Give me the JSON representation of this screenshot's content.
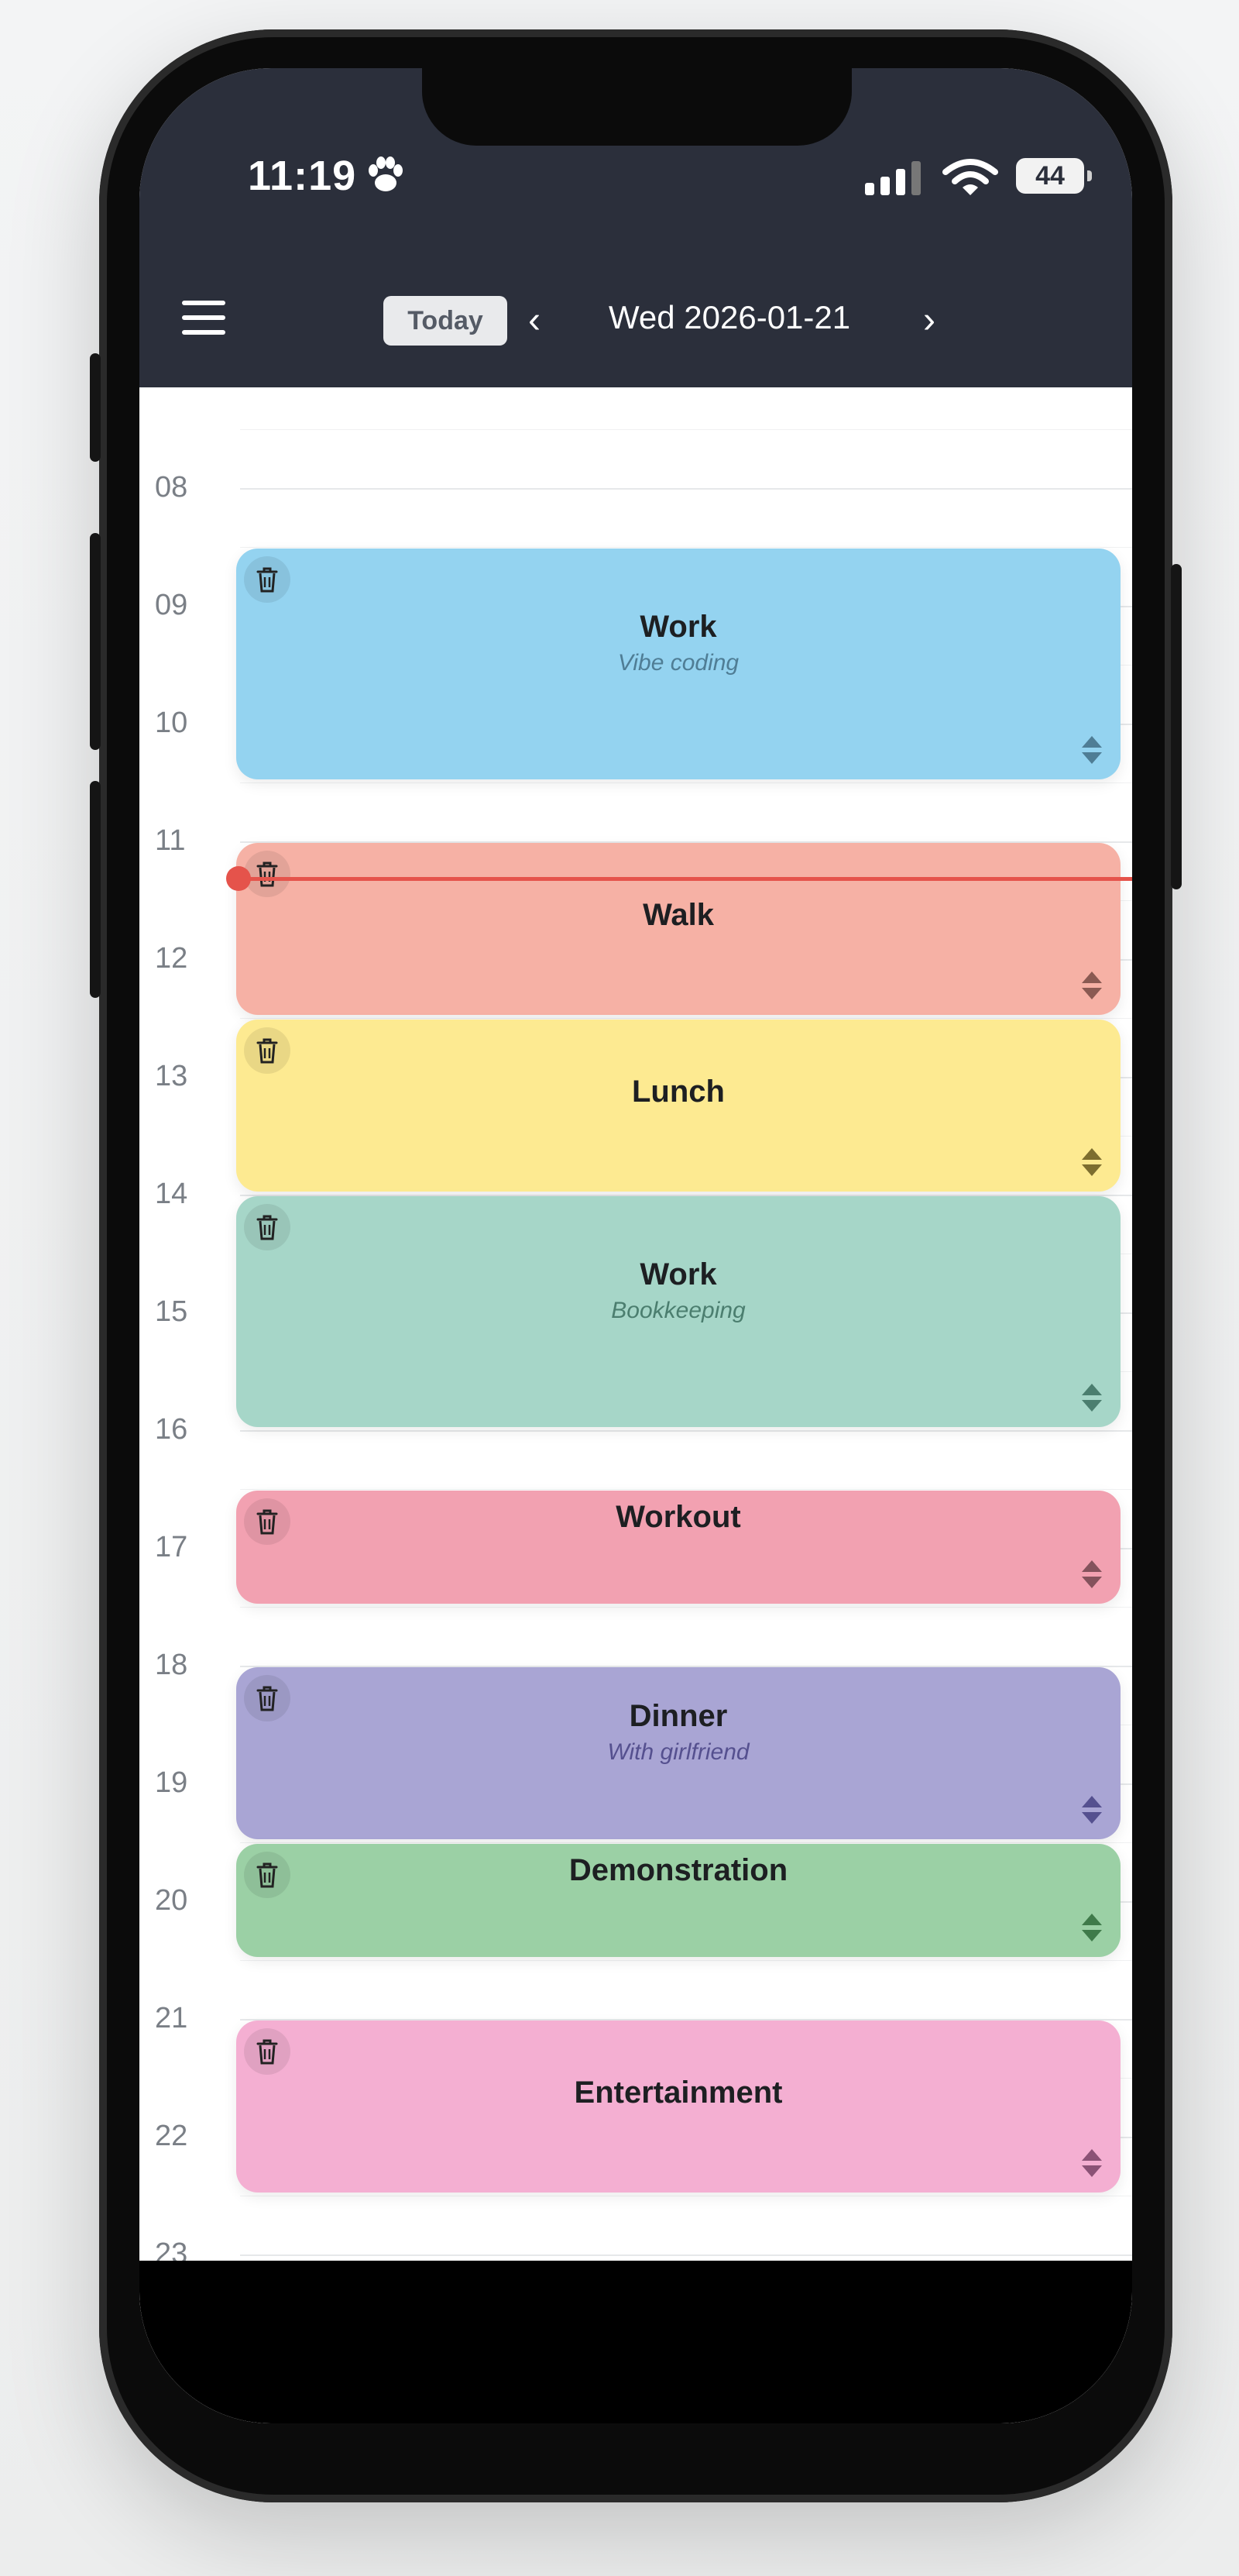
{
  "status_bar": {
    "time": "11:19",
    "battery": "44"
  },
  "header": {
    "today_label": "Today",
    "date": "Wed 2026-01-21"
  },
  "icons": {
    "menu": "menu-icon",
    "prev": "chevron-left-icon",
    "next": "chevron-right-icon",
    "trash": "trash-icon",
    "resize": "resize-handle-icon",
    "paw": "paw-icon",
    "signal": "signal-icon",
    "wifi": "wifi-icon"
  },
  "hours": [
    "08",
    "09",
    "10",
    "11",
    "12",
    "13",
    "14",
    "15",
    "16",
    "17",
    "18",
    "19",
    "20",
    "21",
    "22",
    "23"
  ],
  "events": [
    {
      "title": "Work",
      "subtitle": "Vibe coding",
      "start": "08:30",
      "end": "10:30",
      "color": "#94d3f0",
      "accent": "#4f7d95"
    },
    {
      "title": "Walk",
      "subtitle": "",
      "start": "11:00",
      "end": "12:30",
      "color": "#f6b1a5",
      "accent": "#8a5a52"
    },
    {
      "title": "Lunch",
      "subtitle": "",
      "start": "12:30",
      "end": "14:00",
      "color": "#fdea91",
      "accent": "#7d6e2f"
    },
    {
      "title": "Work",
      "subtitle": "Bookkeeping",
      "start": "14:00",
      "end": "16:00",
      "color": "#a6d6c8",
      "accent": "#4b7e6f"
    },
    {
      "title": "Workout",
      "subtitle": "",
      "start": "16:30",
      "end": "17:30",
      "color": "#f2a1b1",
      "accent": "#84525c"
    },
    {
      "title": "Dinner",
      "subtitle": "With girlfriend",
      "start": "18:00",
      "end": "19:30",
      "color": "#a9a5d4",
      "accent": "#55508f"
    },
    {
      "title": "Demonstration",
      "subtitle": "",
      "start": "19:30",
      "end": "20:30",
      "color": "#9bd0a5",
      "accent": "#3f7a4a"
    },
    {
      "title": "Entertainment",
      "subtitle": "",
      "start": "21:00",
      "end": "22:30",
      "color": "#f4afd2",
      "accent": "#8b5276"
    }
  ],
  "now_time": "11:19"
}
